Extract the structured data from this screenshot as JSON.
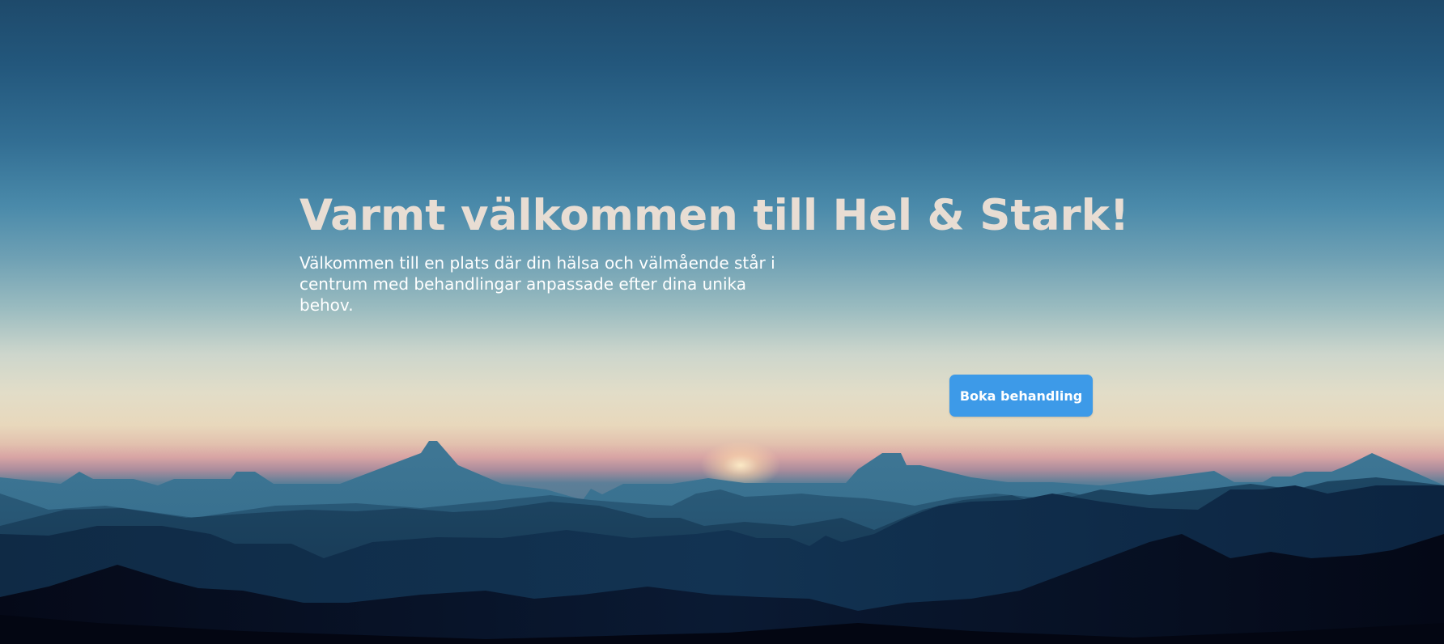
{
  "hero": {
    "title": "Varmt välkommen till Hel & Stark!",
    "subtitle": "Välkommen till en plats där din hälsa och välmående står i centrum med behandlingar anpassade efter dina unika behov.",
    "cta_label": "Boka behandling"
  },
  "colors": {
    "title": "#e8ddd3",
    "subtitle": "#ffffff",
    "button_bg": "#3d9ae8",
    "button_text": "#ffffff",
    "sky_top": "#1e4a6b",
    "sky_horizon": "#e8d8bc",
    "mountains_dark": "#050a1a"
  },
  "background": {
    "scene": "mountain-sunset"
  }
}
